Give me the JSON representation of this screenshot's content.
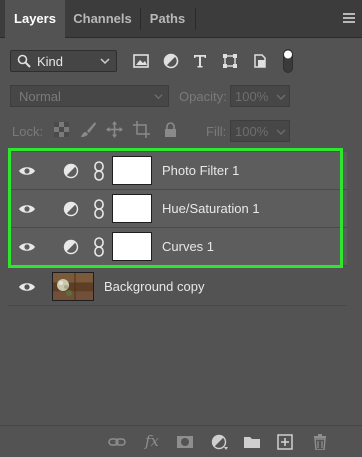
{
  "tabs": [
    {
      "label": "Layers",
      "active": true
    },
    {
      "label": "Channels",
      "active": false
    },
    {
      "label": "Paths",
      "active": false
    }
  ],
  "filter": {
    "kind_label": "Kind",
    "icons": [
      "image-filter-icon",
      "adjustment-filter-icon",
      "type-filter-icon",
      "shape-filter-icon",
      "smart-object-filter-icon"
    ]
  },
  "blend": {
    "mode_label": "Normal",
    "opacity_label": "Opacity:",
    "opacity_value": "100%",
    "fill_label": "Fill:",
    "fill_value": "100%"
  },
  "lock": {
    "label": "Lock:"
  },
  "layers": [
    {
      "name": "Photo Filter 1",
      "type": "adjustment",
      "visible": true,
      "selected_highlight": true
    },
    {
      "name": "Hue/Saturation 1",
      "type": "adjustment",
      "visible": true,
      "selected_highlight": true
    },
    {
      "name": "Curves 1",
      "type": "adjustment",
      "visible": true,
      "selected_highlight": true
    },
    {
      "name": "Background copy",
      "type": "pixel",
      "visible": true,
      "selected_highlight": false
    }
  ],
  "colors": {
    "panel_bg": "#535353",
    "tab_bar_bg": "#3c3c3c",
    "highlight_border": "#2ee62e"
  }
}
